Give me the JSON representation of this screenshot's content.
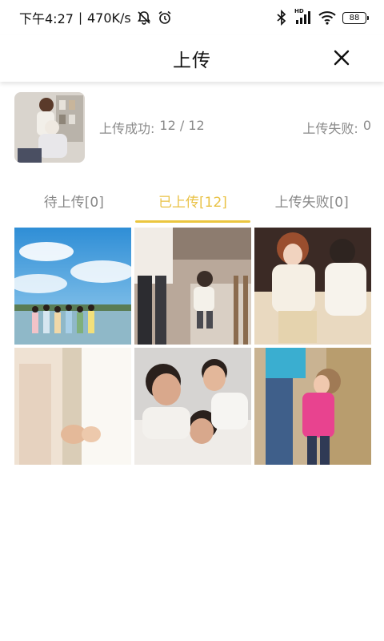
{
  "status_bar": {
    "time": "下午4:27",
    "speed": "470K/s",
    "battery": "88",
    "signal_label": "HD"
  },
  "header": {
    "title": "上传"
  },
  "summary": {
    "success_label": "上传成功:",
    "success_count": "12 / 12",
    "failed_label": "上传失败:",
    "failed_count": "0"
  },
  "tabs": [
    {
      "label": "待上传[0]",
      "active": false
    },
    {
      "label": "已上传[12]",
      "active": true
    },
    {
      "label": "上传失败[0]",
      "active": false
    }
  ],
  "colors": {
    "accent": "#ebc63f",
    "muted_text": "#8a8a8a"
  },
  "photos": [
    {
      "name": "beach-girls-photo"
    },
    {
      "name": "toddler-walking-photo"
    },
    {
      "name": "mother-daughter-sofa-photo"
    },
    {
      "name": "holding-hands-photo"
    },
    {
      "name": "smiling-family-photo"
    },
    {
      "name": "kiss-child-field-photo"
    }
  ]
}
